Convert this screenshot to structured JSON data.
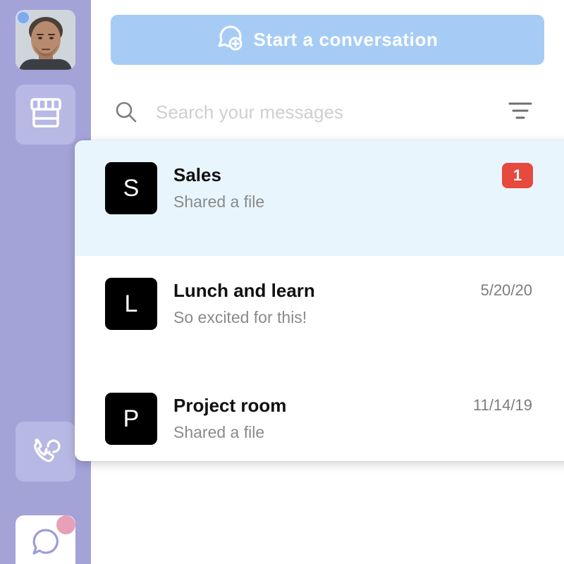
{
  "sidebar": {
    "avatar_alt": "user-avatar",
    "items": [
      {
        "name": "store",
        "icon": "storefront-icon"
      },
      {
        "name": "calls",
        "icon": "phone-call-icon"
      },
      {
        "name": "chat",
        "icon": "chat-bubble-icon",
        "active": true
      }
    ],
    "colors": {
      "background": "#a3a3d8",
      "button": "#b8b8e4",
      "presence": "#7ea9ec",
      "notification": "#e8a0b8"
    }
  },
  "actions": {
    "start_conversation": {
      "label": "Start a conversation",
      "icon": "chat-add-icon",
      "color": "#a6ccf6"
    }
  },
  "search": {
    "placeholder": "Search your messages",
    "value": "",
    "icon": "search-icon",
    "filter_icon": "filter-icon"
  },
  "conversations": [
    {
      "initial": "S",
      "name": "Sales",
      "preview": "Shared a file",
      "date": "",
      "unread": "1",
      "active": true
    },
    {
      "initial": "L",
      "name": "Lunch and learn",
      "preview": "So excited for this!",
      "date": "5/20/20",
      "unread": "",
      "active": false
    },
    {
      "initial": "P",
      "name": "Project room",
      "preview": "Shared a file",
      "date": "11/14/19",
      "unread": "",
      "active": false
    }
  ],
  "colors": {
    "active_row": "#e8f5fd",
    "unread_badge": "#e6493d"
  }
}
